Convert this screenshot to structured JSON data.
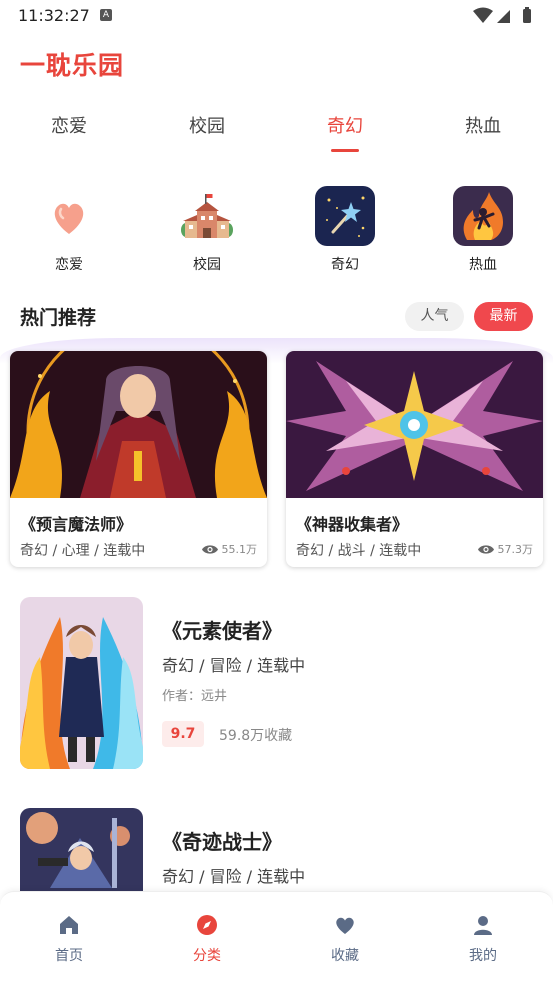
{
  "status": {
    "time": "11:32:27",
    "a_badge": "A"
  },
  "app_title": "一耽乐园",
  "tabs": [
    {
      "label": "恋爱"
    },
    {
      "label": "校园"
    },
    {
      "label": "奇幻"
    },
    {
      "label": "热血"
    }
  ],
  "active_tab": "奇幻",
  "categories": [
    {
      "label": "恋爱",
      "icon": "heart-icon"
    },
    {
      "label": "校园",
      "icon": "school-building-icon"
    },
    {
      "label": "奇幻",
      "icon": "magic-wand-icon"
    },
    {
      "label": "热血",
      "icon": "flame-warrior-icon"
    }
  ],
  "section": {
    "title": "热门推荐",
    "filter_hot": "人气",
    "filter_new": "最新",
    "active_filter": "最新"
  },
  "featured": [
    {
      "title": "《预言魔法师》",
      "tags": "奇幻 / 心理 / 连载中",
      "views": "55.1万"
    },
    {
      "title": "《神器收集者》",
      "tags": "奇幻 / 战斗 / 连载中",
      "views": "57.3万"
    }
  ],
  "list": [
    {
      "title": "《元素使者》",
      "tags": "奇幻 / 冒险 / 连载中",
      "author": "作者：远井",
      "score": "9.7",
      "favorites": "59.8万收藏"
    },
    {
      "title": "《奇迹战士》",
      "tags": "奇幻 / 冒险 / 连载中"
    }
  ],
  "nav": [
    {
      "label": "首页",
      "icon": "home-icon"
    },
    {
      "label": "分类",
      "icon": "compass-icon"
    },
    {
      "label": "收藏",
      "icon": "heart-icon"
    },
    {
      "label": "我的",
      "icon": "user-icon"
    }
  ],
  "active_nav": "分类",
  "colors": {
    "accent": "#e8453c",
    "nav_inactive": "#5b6b86"
  }
}
